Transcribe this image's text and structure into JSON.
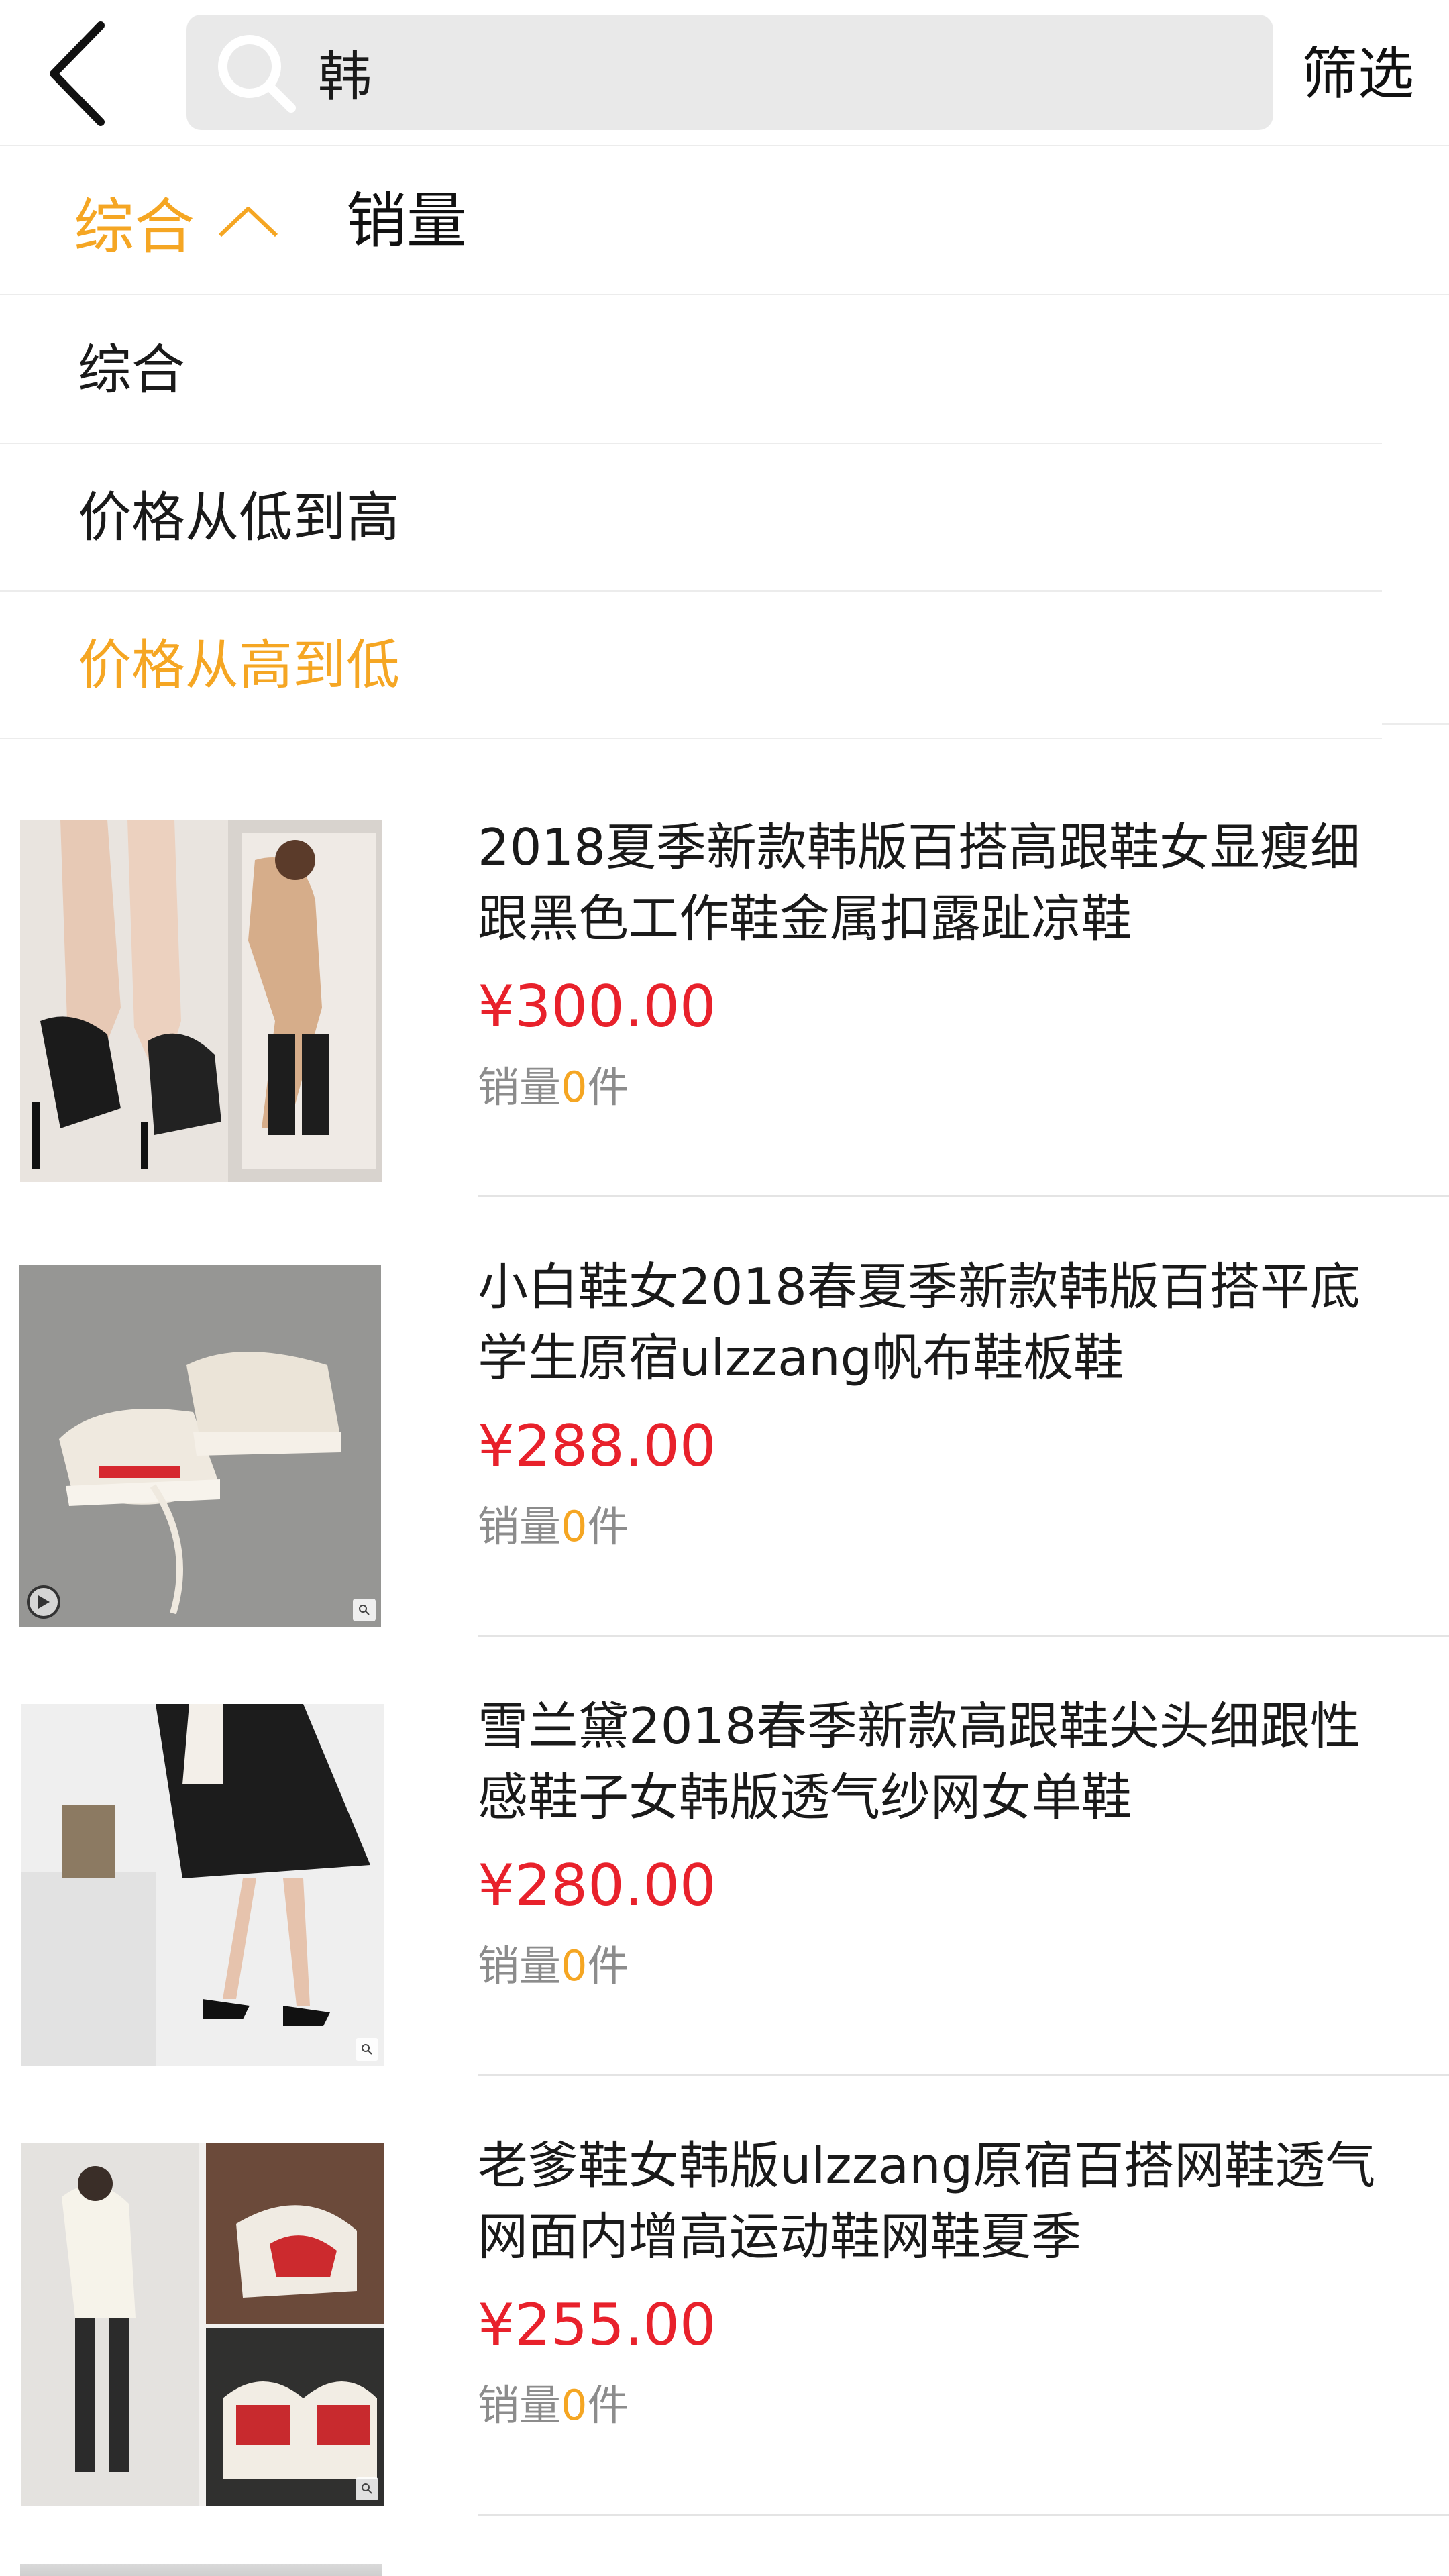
{
  "header": {
    "search_query": "韩",
    "filter_label": "筛选"
  },
  "sortbar": {
    "comprehensive_label": "综合",
    "sales_label": "销量",
    "accent_color": "#f5a623"
  },
  "dropdown": {
    "options": [
      {
        "label": "综合",
        "selected": false
      },
      {
        "label": "价格从低到高",
        "selected": false
      },
      {
        "label": "价格从高到低",
        "selected": true
      }
    ]
  },
  "products": [
    {
      "title": "2018夏季新款韩版百搭高跟鞋女显瘦细跟黑色工作鞋金属扣露趾凉鞋",
      "price": "¥300.00",
      "sales_prefix": "销量",
      "sales_count": "0",
      "sales_unit": "件",
      "image": "black-strappy-heeled-sandals"
    },
    {
      "title": "小白鞋女2018春夏季新款韩版百搭平底学生原宿ulzzang帆布鞋板鞋",
      "price": "¥288.00",
      "sales_prefix": "销量",
      "sales_count": "0",
      "sales_unit": "件",
      "image": "white-canvas-sneakers"
    },
    {
      "title": "雪兰黛2018春季新款高跟鞋尖头细跟性感鞋子女韩版透气纱网女单鞋",
      "price": "¥280.00",
      "sales_prefix": "销量",
      "sales_count": "0",
      "sales_unit": "件",
      "image": "black-pointed-mesh-heels"
    },
    {
      "title": "老爹鞋女韩版ulzzang原宿百搭网鞋透气网面内增高运动鞋网鞋夏季",
      "price": "¥255.00",
      "sales_prefix": "销量",
      "sales_count": "0",
      "sales_unit": "件",
      "image": "chunky-dad-sneakers"
    }
  ]
}
